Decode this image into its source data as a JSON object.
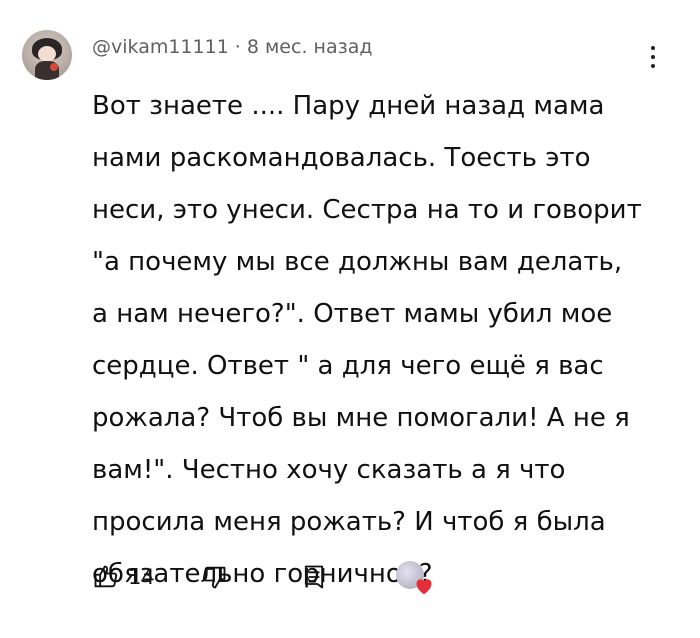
{
  "comment": {
    "author": "@vikam11111",
    "separator": "·",
    "timestamp": "8 мес. назад",
    "text_lines": [
      "Вот знаете .... Пару дней назад мама",
      "нами раскомандовалась. Тоесть это",
      "неси, это унеси. Сестра на то и говорит",
      "\"а почему мы все должны вам делать,",
      "а нам нечего?\". Ответ мамы убил мое",
      "сердце. Ответ \" а для чего ещё я вас",
      "рожала? Чтоб вы мне помогали! А не я",
      "вам!\". Честно хочу сказать а я что",
      "просила меня рожать? И чтоб я была",
      "обязательно горничной?"
    ]
  },
  "actions": {
    "like_count": "14"
  },
  "colors": {
    "text": "#111111",
    "meta": "#606060",
    "heart": "#e52d3a"
  },
  "icons": {
    "menu": "more-vert-icon",
    "like": "thumb-up-icon",
    "dislike": "thumb-down-icon",
    "reply": "reply-comment-icon",
    "creator_heart": "creator-heart-icon"
  }
}
